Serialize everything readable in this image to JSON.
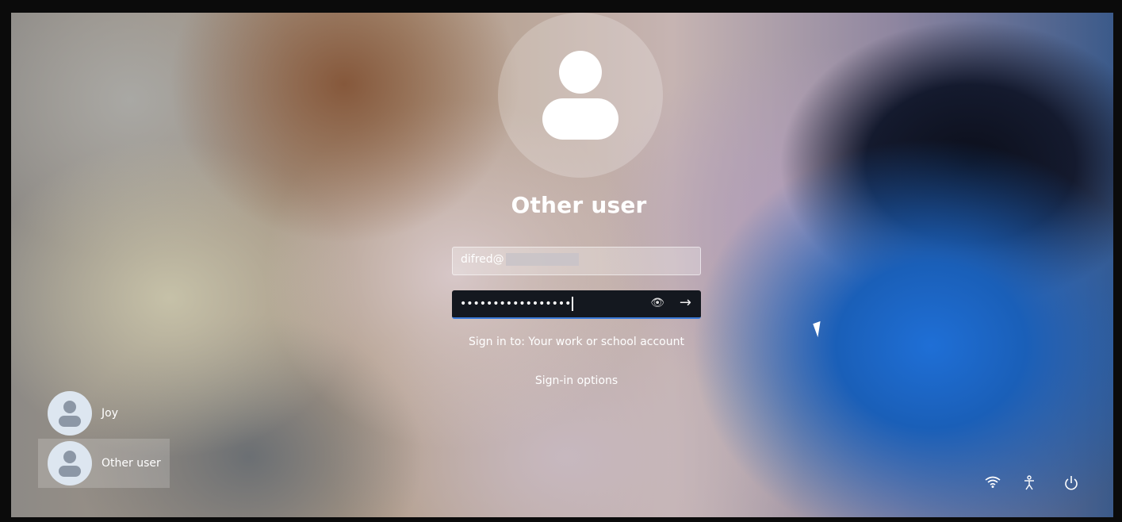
{
  "login": {
    "title": "Other user",
    "email_value": "difred@",
    "password_mask": "•••••••••••••••••",
    "signin_to": "Sign in to: Your work or school account",
    "signin_options": "Sign-in options"
  },
  "users": [
    {
      "name": "Joy"
    },
    {
      "name": "Other user"
    }
  ],
  "icons": {
    "reveal": "👁",
    "submit": "→",
    "wifi": "wifi-icon",
    "accessibility": "accessibility-icon",
    "power": "power-icon"
  }
}
